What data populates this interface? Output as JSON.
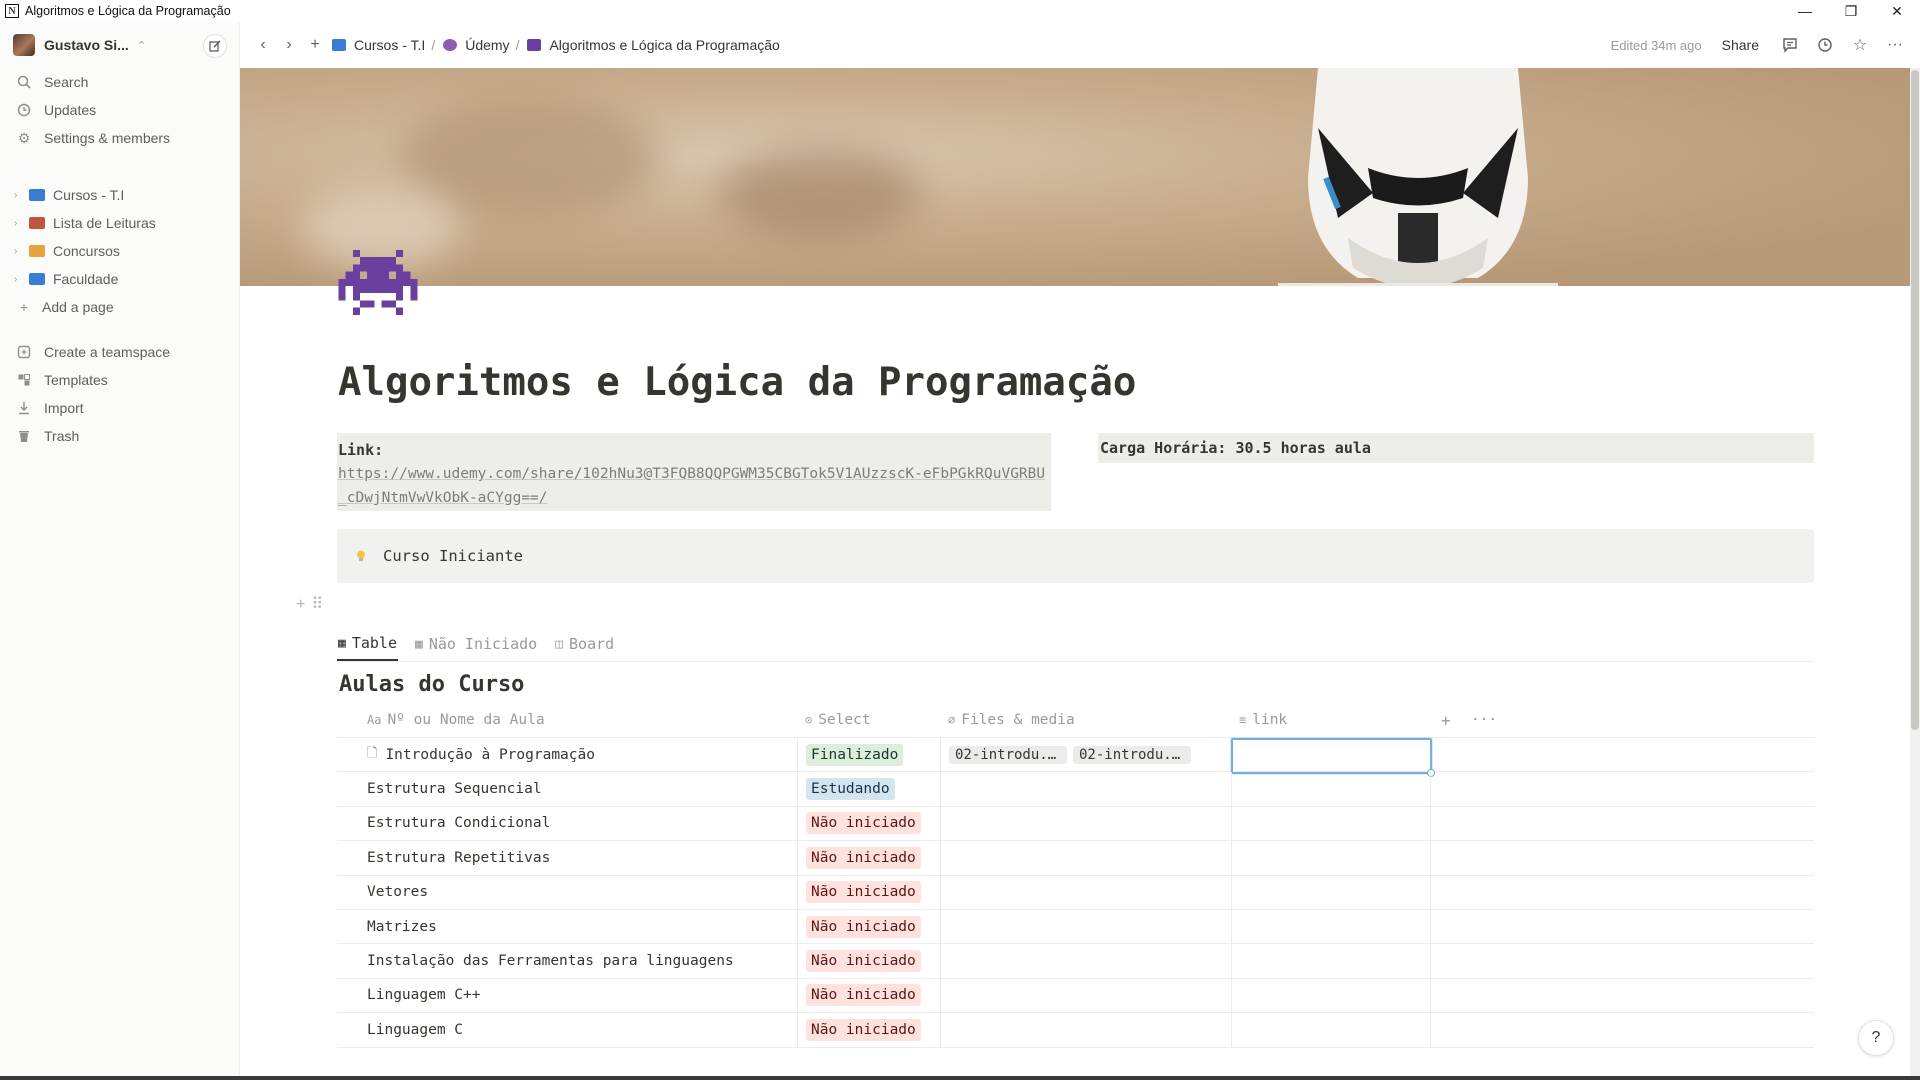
{
  "window": {
    "title": "Algoritmos e Lógica da Programação",
    "controls": [
      "—",
      "❐",
      "✕"
    ]
  },
  "sidebar": {
    "workspace_name": "Gustavo Si...",
    "nav": [
      {
        "label": "Search",
        "icon": "search-icon"
      },
      {
        "label": "Updates",
        "icon": "clock-icon"
      },
      {
        "label": "Settings & members",
        "icon": "gear-icon"
      }
    ],
    "pages": [
      {
        "label": "Cursos - T.I",
        "icon": "laptop-icon",
        "color": "#3a7bd5"
      },
      {
        "label": "Lista de Leituras",
        "icon": "books-icon",
        "color": "#c0563d"
      },
      {
        "label": "Concursos",
        "icon": "folder-icon",
        "color": "#e6a23c"
      },
      {
        "label": "Faculdade",
        "icon": "laptop-icon",
        "color": "#3a7bd5"
      }
    ],
    "add_page": "Add a page",
    "bottom": [
      {
        "label": "Create a teamspace",
        "icon": "teamspace-icon"
      },
      {
        "label": "Templates",
        "icon": "templates-icon"
      },
      {
        "label": "Import",
        "icon": "import-icon"
      },
      {
        "label": "Trash",
        "icon": "trash-icon"
      }
    ]
  },
  "topbar": {
    "breadcrumbs": [
      {
        "label": "Cursos - T.I",
        "sep": "/"
      },
      {
        "label": "Údemy",
        "sep": "/"
      },
      {
        "label": "Algoritmos e Lógica da Programação",
        "sep": ""
      }
    ],
    "edited": "Edited 34m ago",
    "share": "Share"
  },
  "page": {
    "title": "Algoritmos e Lógica da Programação",
    "link_label": "Link:",
    "link_url": "https://www.udemy.com/share/102hNu3@T3FQB8QQPGWM35CBGTok5V1AUzzscK-eFbPGkRQuVGRBU_cDwjNtmVwVkObK-aCYgg==/",
    "carga": "Carga Horária: 30.5 horas aula",
    "callout": "Curso Iniciante"
  },
  "database": {
    "views": [
      {
        "label": "Table",
        "active": true
      },
      {
        "label": "Não Iniciado",
        "active": false
      },
      {
        "label": "Board",
        "active": false
      }
    ],
    "title": "Aulas do Curso",
    "columns": {
      "name": "Nº ou Nome da Aula",
      "select": "Select",
      "files": "Files & media",
      "link": "link"
    },
    "rows": [
      {
        "name": "Introdução à Programação",
        "status": "Finalizado",
        "files": [
          "02-introdu...",
          "02-introdu..."
        ],
        "has_doc_icon": true
      },
      {
        "name": "Estrutura Sequencial",
        "status": "Estudando",
        "files": []
      },
      {
        "name": "Estrutura Condicional",
        "status": "Não iniciado",
        "files": []
      },
      {
        "name": "Estrutura Repetitivas",
        "status": "Não iniciado",
        "files": []
      },
      {
        "name": "Vetores",
        "status": "Não iniciado",
        "files": []
      },
      {
        "name": "Matrizes",
        "status": "Não iniciado",
        "files": []
      },
      {
        "name": "Instalação das Ferramentas para linguagens",
        "status": "Não iniciado",
        "files": []
      },
      {
        "name": "Linguagem C++",
        "status": "Não iniciado",
        "files": []
      },
      {
        "name": "Linguagem C",
        "status": "Não iniciado",
        "files": []
      }
    ],
    "status_colors": {
      "Finalizado": {
        "bg": "#dbeddb",
        "fg": "#1c3829"
      },
      "Estudando": {
        "bg": "#d3e5ef",
        "fg": "#183347"
      },
      "Não iniciado": {
        "bg": "#ffe2dd",
        "fg": "#5d1715"
      }
    }
  },
  "help": "?"
}
